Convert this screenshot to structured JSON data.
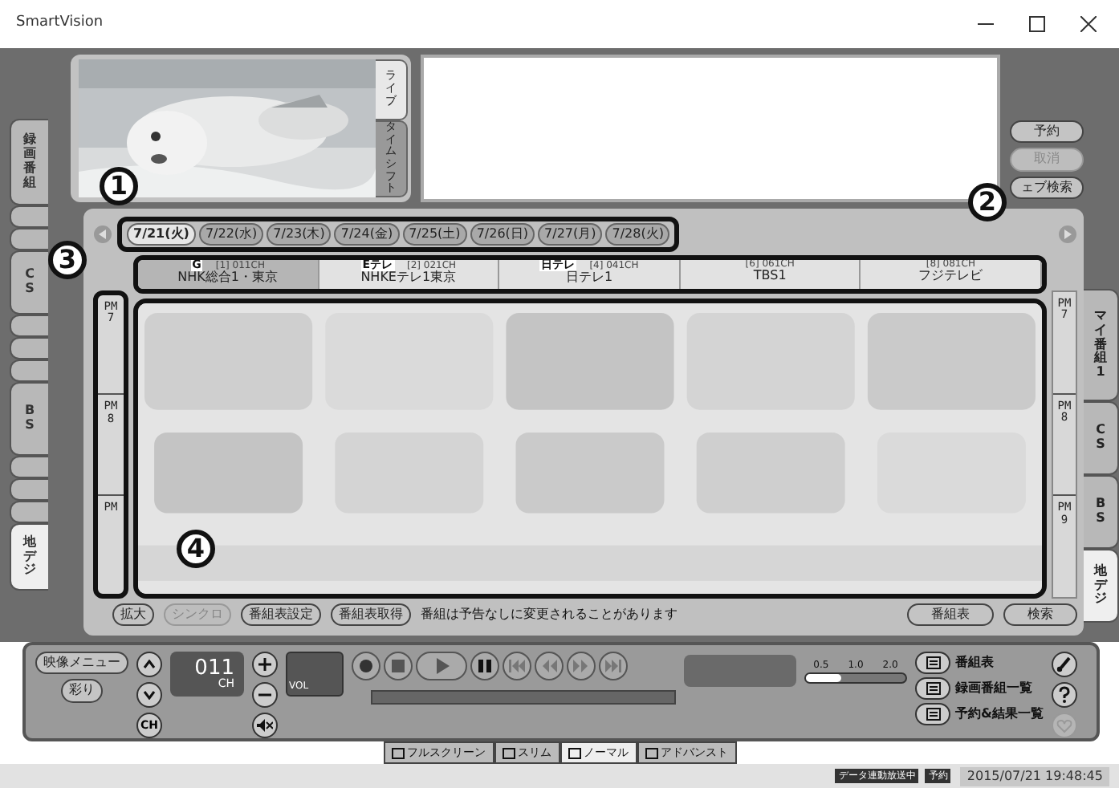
{
  "window": {
    "title": "SmartVision"
  },
  "left_tabs": [
    {
      "kind": "text",
      "label": "録画番組",
      "selected": false
    },
    {
      "kind": "blank",
      "selected": false
    },
    {
      "kind": "blank",
      "selected": false
    },
    {
      "kind": "text",
      "label": "CS",
      "selected": false
    },
    {
      "kind": "blank",
      "selected": false
    },
    {
      "kind": "blank",
      "selected": false
    },
    {
      "kind": "blank",
      "selected": false
    },
    {
      "kind": "text",
      "label": "BS",
      "selected": false
    },
    {
      "kind": "blank",
      "selected": false
    },
    {
      "kind": "blank",
      "selected": false
    },
    {
      "kind": "blank",
      "selected": false
    },
    {
      "kind": "text",
      "label": "地デジ",
      "selected": true
    }
  ],
  "video": {
    "kind": "picture",
    "tabs": [
      {
        "label": "ライブ",
        "selected": true
      },
      {
        "label": "タイムシフト",
        "selected": false
      }
    ]
  },
  "info_buttons": [
    {
      "label": "予約",
      "disabled": false
    },
    {
      "label": "取消",
      "disabled": true
    },
    {
      "label": "ェブ検索",
      "disabled": false
    }
  ],
  "dates": [
    {
      "label": "7/21(火)",
      "selected": true
    },
    {
      "label": "7/22(水)",
      "selected": false
    },
    {
      "label": "7/23(木)",
      "selected": false
    },
    {
      "label": "7/24(金)",
      "selected": false
    },
    {
      "label": "7/25(土)",
      "selected": false
    },
    {
      "label": "7/26(日)",
      "selected": false
    },
    {
      "label": "7/27(月)",
      "selected": false
    },
    {
      "label": "7/28(火)",
      "selected": false
    }
  ],
  "channels": [
    {
      "logo": "G",
      "number": "[1] 011CH",
      "name": "NHK総合1・東京",
      "selected": true
    },
    {
      "logo": "Eテレ",
      "number": "[2] 021CH",
      "name": "NHKEテレ1東京",
      "selected": false
    },
    {
      "logo": "日テレ",
      "number": "[4] 041CH",
      "name": "日テレ1",
      "selected": false
    },
    {
      "number": "[6] 061CH",
      "name": "TBS1",
      "selected": false
    },
    {
      "number": "[8] 081CH",
      "name": "フジテレビ",
      "selected": false
    }
  ],
  "times_left": [
    {
      "period": "PM",
      "hour": "7"
    },
    {
      "period": "PM",
      "hour": "8"
    },
    {
      "period": "PM"
    }
  ],
  "times_right": [
    {
      "period": "PM",
      "hour": "7"
    },
    {
      "period": "PM",
      "hour": "8"
    },
    {
      "period": "PM",
      "hour": "9"
    }
  ],
  "guide": {
    "kind": "picture"
  },
  "right_tabs": [
    {
      "label": "マイ番組1",
      "selected": false
    },
    {
      "label": "CS",
      "selected": false
    },
    {
      "label": "BS",
      "selected": false
    },
    {
      "label": "地デジ",
      "selected": true
    }
  ],
  "guide_buttons": [
    {
      "label": "拡大",
      "disabled": false
    },
    {
      "label": "シンクロ",
      "disabled": true
    },
    {
      "label": "番組表設定",
      "disabled": false
    },
    {
      "label": "番組表取得",
      "disabled": false
    }
  ],
  "guide_notice": "番組は予告なしに変更されることがあります",
  "guide_buttons_right": [
    {
      "label": "番組表",
      "disabled": false
    },
    {
      "label": "検索",
      "disabled": false
    }
  ],
  "player": {
    "menu_buttons": [
      "映像メニュー",
      "彩り"
    ],
    "channel_button": "CH",
    "channel": "011",
    "channel_unit": "CH",
    "volume_label": "VOL",
    "speed_ticks": [
      "0.5",
      "1.0",
      "2.0"
    ],
    "speed_slider": {
      "level": 0.35
    }
  },
  "shortcuts": [
    "番組表",
    "録画番組一覧",
    "予約&結果一覧"
  ],
  "view_modes": [
    {
      "label": "フルスクリーン",
      "selected": false
    },
    {
      "label": "スリム",
      "selected": false
    },
    {
      "label": "ノーマル",
      "selected": true
    },
    {
      "label": "アドバンスト",
      "selected": false
    }
  ],
  "status_bar": {
    "badges": [
      "データ連動放送中",
      "予約"
    ],
    "clock": "2015/07/21 19:48:45"
  },
  "callouts": [
    {
      "label": "1"
    },
    {
      "label": "2"
    },
    {
      "label": "3"
    },
    {
      "label": "4"
    }
  ]
}
